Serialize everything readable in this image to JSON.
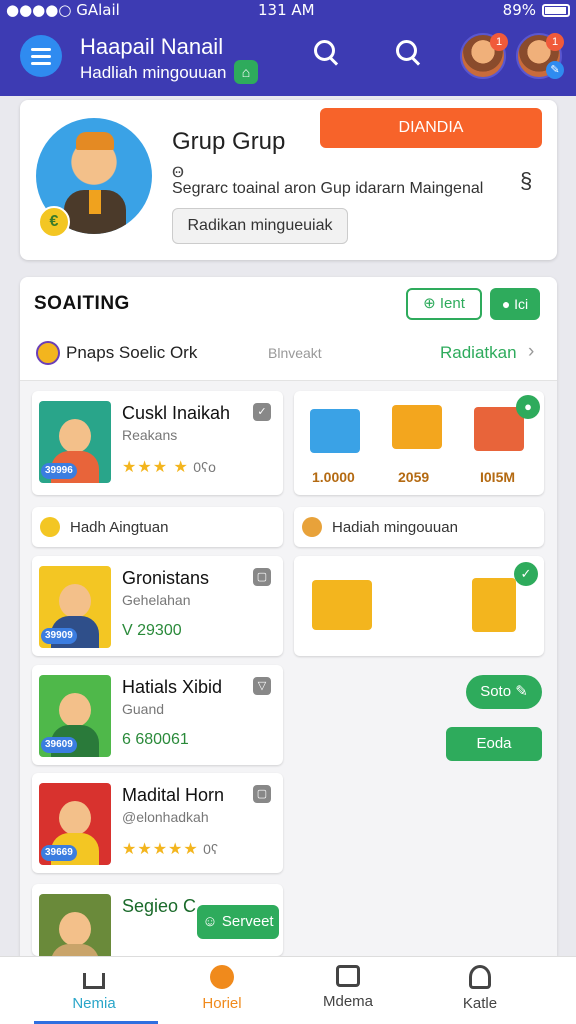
{
  "status_bar": {
    "carrier": "●●●●○ GAl‍ail",
    "time": "131 AM",
    "battery": "89%"
  },
  "header": {
    "title": "Haapail Nanail",
    "subtitle": "Hadliah mingouuan"
  },
  "profile": {
    "name": "Grup Grup",
    "small_text": "Ꙫ",
    "description": "Segrarc toainal aron Gup idararn Maingenal",
    "secondary_button": "Radikan mingueuiak",
    "primary_button": "DIANDIA"
  },
  "section": {
    "title": "SOAITING",
    "btn_outline": "Ient",
    "btn_green": "Ici",
    "filter_label": "Pnaps Soelic Ork",
    "filter_mid": "Blnveakt",
    "filter_link": "Radiatkan"
  },
  "cards": [
    {
      "title": "Cuskl Inaikah",
      "sub": "Reakans",
      "tag": "39996",
      "foot_stars": "★★★ ★",
      "foot_count": "0ʕo"
    },
    {
      "title": "Gronistans",
      "sub": "Gehelahan",
      "tag": "39909",
      "foot_value": "V 29300"
    },
    {
      "title": "Hatials Xibid",
      "sub": "Guand",
      "tag": "39609",
      "foot_value": "6 680061"
    },
    {
      "title": "Madital Horn",
      "sub": "@elonhadkah",
      "tag": "39669",
      "foot_stars": "★★★★★",
      "foot_count": "0ʕ"
    },
    {
      "title": "Segieo C",
      "sub": "",
      "tag": "",
      "foot_stars": ""
    }
  ],
  "gifts": {
    "values": [
      "1.0000",
      "2059",
      "I0I5M"
    ]
  },
  "row_pills": {
    "left": "Hadh Aingtuan",
    "right": "Hadiah mingouuan"
  },
  "buttons": {
    "soto": "Soto",
    "eoda": "Eoda",
    "serveet": "Serveet"
  },
  "bottom_nav": [
    {
      "label": "Nemia",
      "color": "#2aa6c9"
    },
    {
      "label": "Horiel",
      "color": "#f08a1c"
    },
    {
      "label": "Mdema",
      "color": "#444444"
    },
    {
      "label": "Katle",
      "color": "#444444"
    }
  ]
}
